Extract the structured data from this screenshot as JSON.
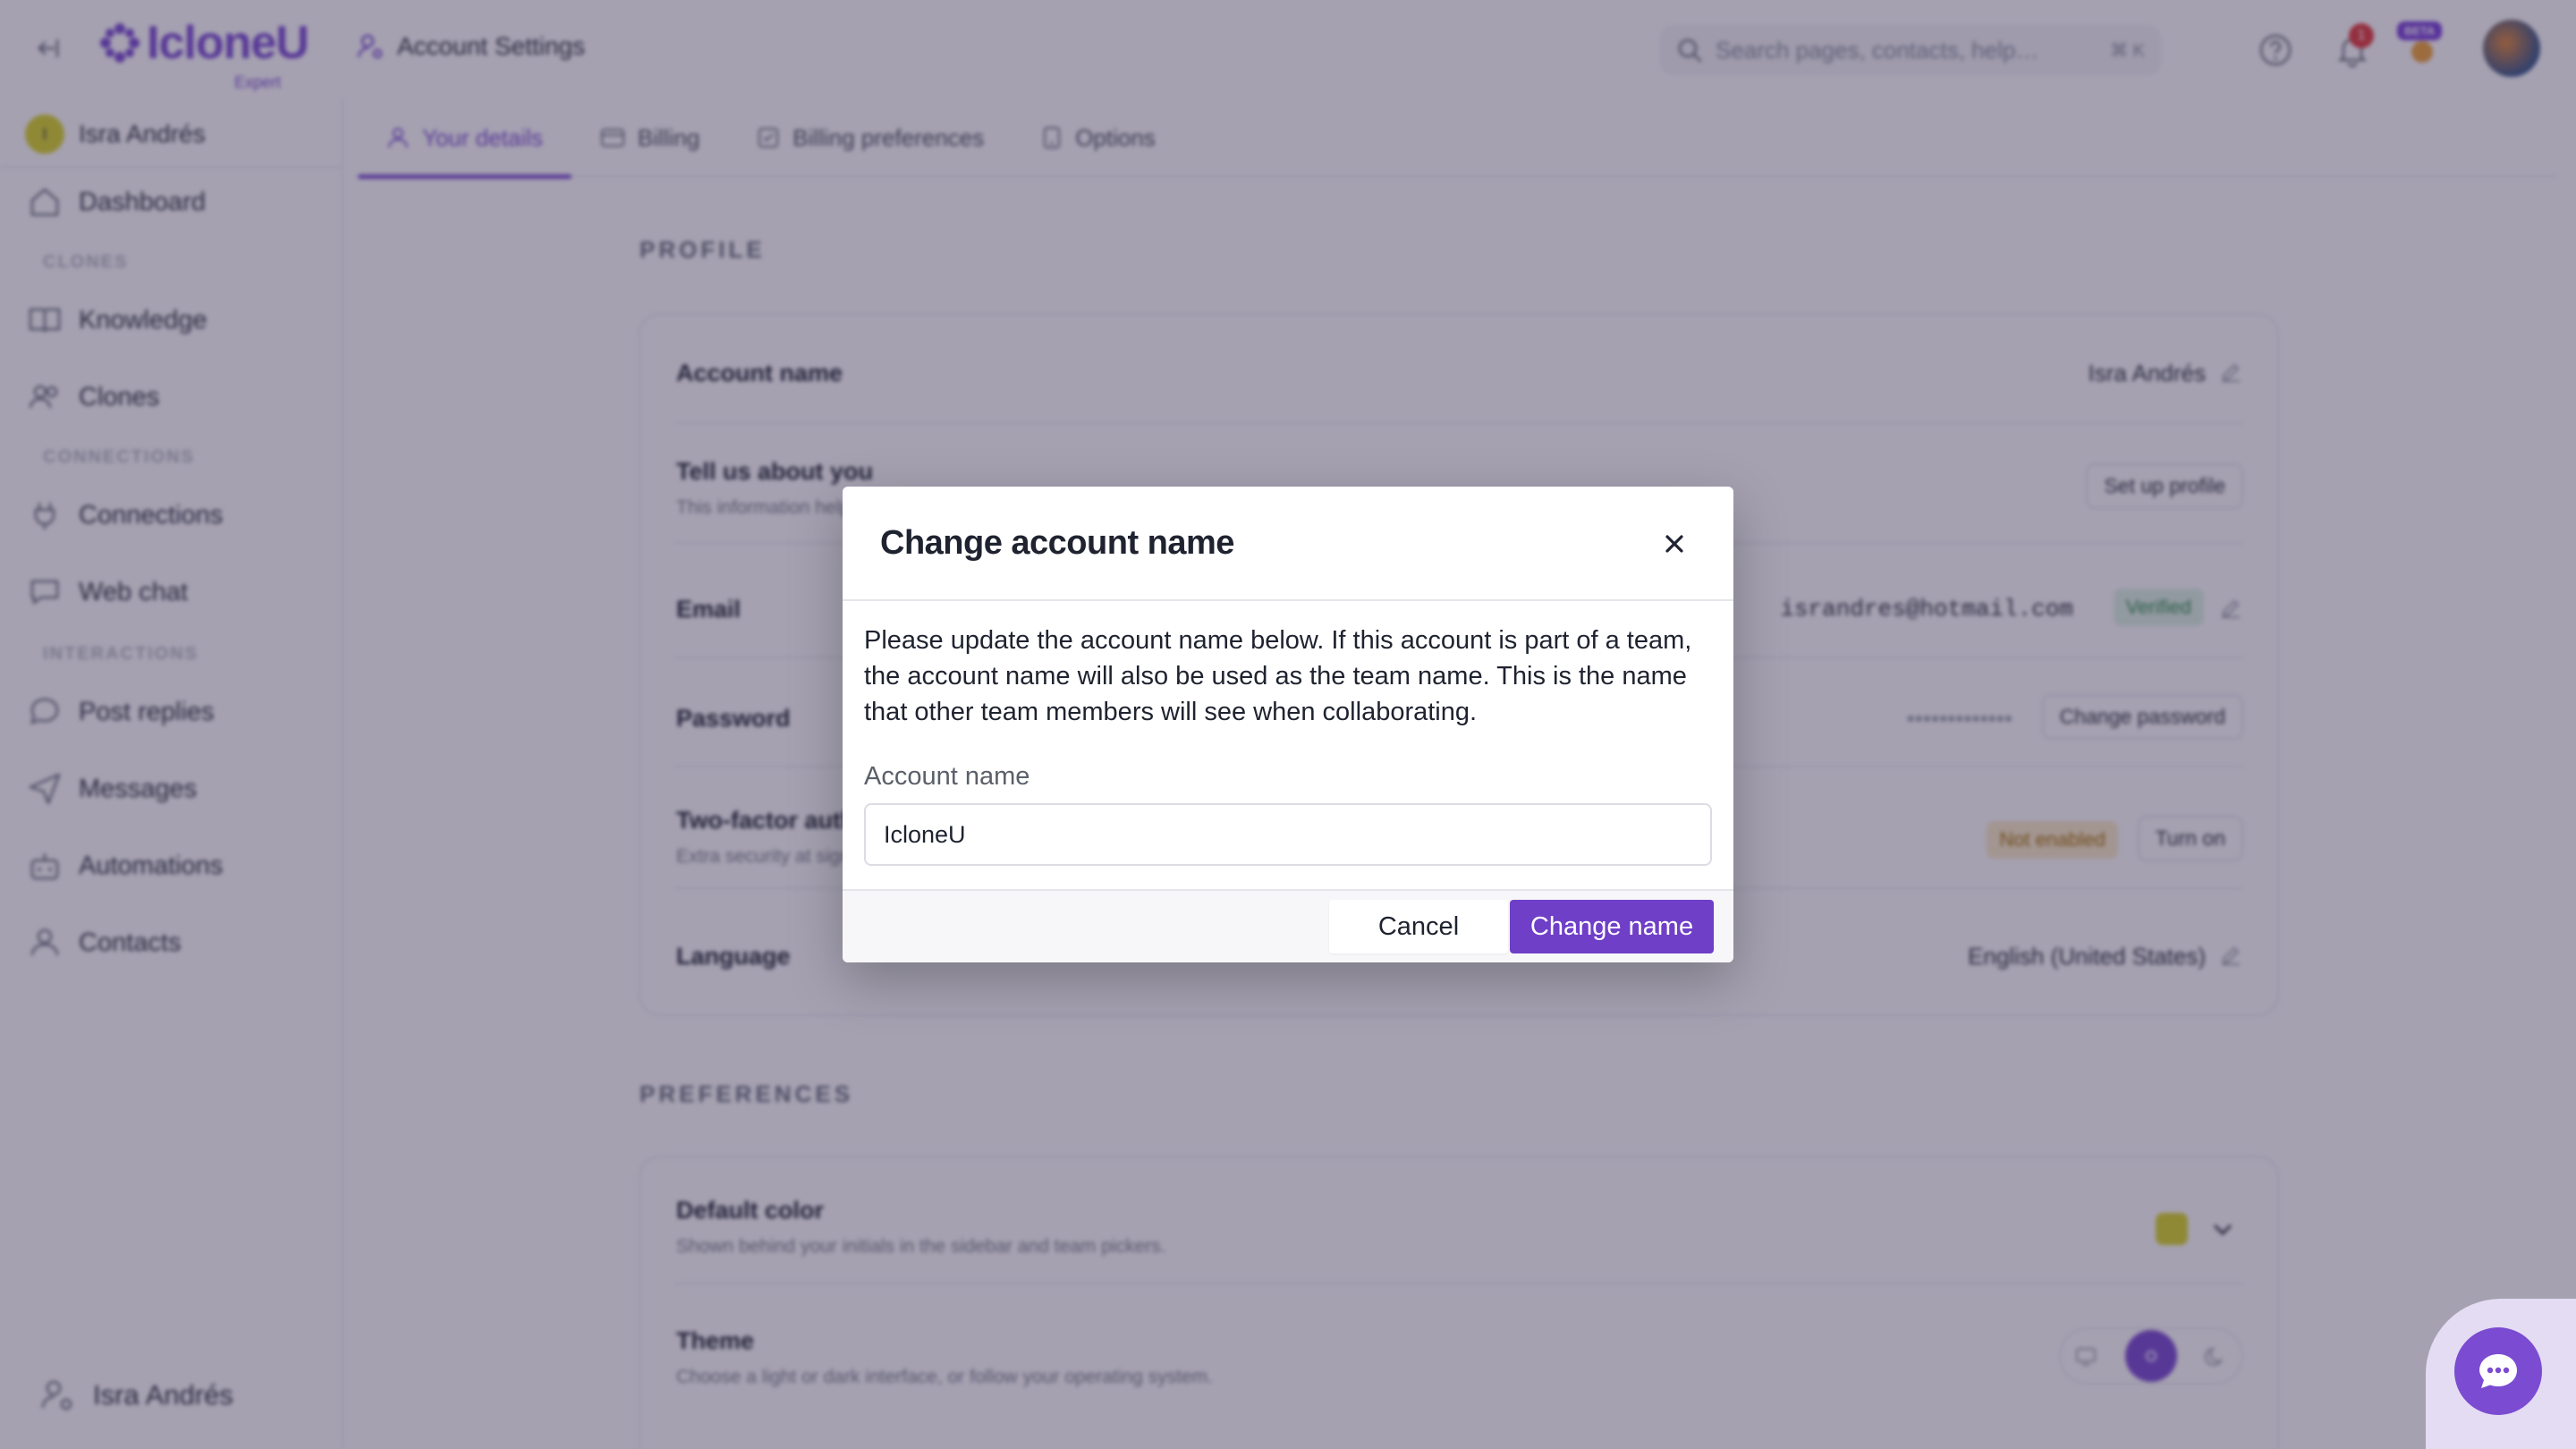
{
  "header": {
    "logo_text": "IcloneU",
    "logo_sub": "Expert",
    "page_title": "Account Settings",
    "search_placeholder": "Search pages, contacts, help…",
    "search_shortcut": "⌘ K",
    "notification_count": "1",
    "beta_label": "BETA"
  },
  "sidebar": {
    "account_initial": "I",
    "account_name": "Isra Andrés",
    "items": [
      {
        "label": "Dashboard"
      },
      {
        "label": "Knowledge"
      },
      {
        "label": "Clones"
      },
      {
        "label": "Connections"
      },
      {
        "label": "Web chat"
      },
      {
        "label": "Post replies"
      },
      {
        "label": "Messages"
      },
      {
        "label": "Automations"
      },
      {
        "label": "Contacts"
      }
    ],
    "sections": [
      "CLONES",
      "CONNECTIONS",
      "INTERACTIONS"
    ],
    "user_name": "Isra Andrés"
  },
  "tabs": [
    {
      "label": "Your details",
      "active": true
    },
    {
      "label": "Billing",
      "active": false
    },
    {
      "label": "Billing preferences",
      "active": false
    },
    {
      "label": "Options",
      "active": false
    }
  ],
  "profile": {
    "section_title": "PROFILE",
    "account_name_label": "Account name",
    "account_name_value": "Isra Andrés",
    "about_label": "Tell us about you",
    "about_desc": "This information helps",
    "about_button": "Set up profile",
    "email_label": "Email",
    "email_value": "israndres@hotmail.com",
    "email_status": "Verified",
    "password_label": "Password",
    "password_value": "•••••••••••••",
    "password_button": "Change password",
    "twofa_label": "Two-factor auth",
    "twofa_desc": "Extra security at sign",
    "twofa_status": "Not enabled",
    "twofa_button": "Turn on",
    "language_label": "Language",
    "language_value": "English (United States)"
  },
  "preferences": {
    "section_title": "PREFERENCES",
    "color_label": "Default color",
    "color_desc": "Shown behind your initials in the sidebar and team pickers.",
    "color_value": "#d9d62c",
    "theme_label": "Theme",
    "theme_desc": "Choose a light or dark interface, or follow your operating system."
  },
  "modal": {
    "title": "Change account name",
    "body": "Please update the account name below. If this account is part of a team, the account name will also be used as the team name. This is the name that other team members will see when collaborating.",
    "field_label": "Account name",
    "field_value": "IcloneU",
    "cancel_label": "Cancel",
    "confirm_label": "Change name"
  },
  "colors": {
    "accent": "#7b4bd1",
    "primary_button": "#6f3fc8"
  }
}
